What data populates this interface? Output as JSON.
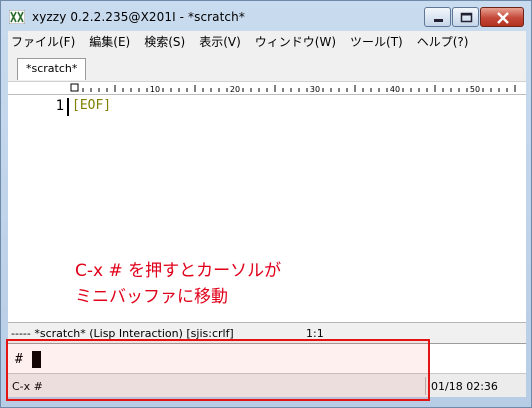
{
  "window": {
    "title": "xyzzy 0.2.2.235@X201I - *scratch*"
  },
  "menu": [
    "ファイル(F)",
    "編集(E)",
    "検索(S)",
    "表示(V)",
    "ウィンドウ(W)",
    "ツール(T)",
    "ヘルプ(?)"
  ],
  "tab": {
    "label": "*scratch*"
  },
  "ruler": {
    "labels": [
      "10",
      "20",
      "30",
      "40",
      "50"
    ]
  },
  "editor": {
    "line_number": "1",
    "eof": "[EOF]"
  },
  "annotation": {
    "line1": "C-x # を押すとカーソルが",
    "line2": "ミニバッファに移動",
    "color": "#e0001a"
  },
  "modeline": {
    "text": "----- *scratch* (Lisp Interaction) [sjis:crlf]",
    "position": "1:1"
  },
  "minibuffer": {
    "prompt": "#"
  },
  "statusbar": {
    "keys": "C-x #",
    "datetime": "01/18 02:36"
  },
  "colors": {
    "highlight": "#e21414",
    "eof": "#808000"
  }
}
